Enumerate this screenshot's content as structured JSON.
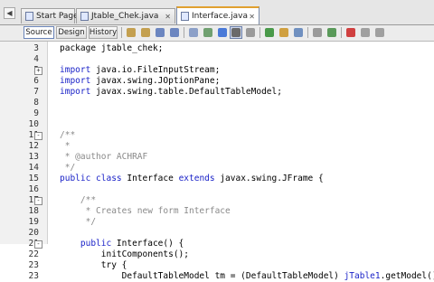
{
  "tabs": [
    {
      "label": "Start Page",
      "active": false
    },
    {
      "label": "Jtable_Chek.java",
      "active": false
    },
    {
      "label": "Interface.java",
      "active": true
    }
  ],
  "toolbar": {
    "modes": [
      "Source",
      "Design",
      "History"
    ],
    "icons": [
      "back-icon",
      "forward-icon",
      "find-previous-icon",
      "find-next-icon",
      "find-selection-icon",
      "toggle-highlight-icon",
      "toggle-bookmark-icon",
      "previous-bookmark-icon",
      "next-bookmark-icon",
      "shift-left-icon",
      "shift-right-icon",
      "start-macro-icon",
      "stop-macro-icon",
      "comment-icon",
      "uncomment-icon"
    ]
  },
  "colors": {
    "keyword": "#1a22c8",
    "comment": "#8a8a8a",
    "gutter": "#f1f1f1",
    "active_tab_marker": "#e0a030"
  },
  "editor": {
    "lines": [
      {
        "num": "3",
        "fold": "",
        "segments": [
          {
            "t": "package jtable_chek;",
            "c": ""
          }
        ]
      },
      {
        "num": "4",
        "fold": "",
        "segments": []
      },
      {
        "num": "5",
        "fold": "+",
        "segments": [
          {
            "t": "import",
            "c": "kw"
          },
          {
            "t": " java.io.FileInputStream;",
            "c": ""
          }
        ]
      },
      {
        "num": "6",
        "fold": "",
        "segments": [
          {
            "t": "import",
            "c": "kw"
          },
          {
            "t": " javax.swing.JOptionPane;",
            "c": ""
          }
        ]
      },
      {
        "num": "7",
        "fold": "",
        "segments": [
          {
            "t": "import",
            "c": "kw"
          },
          {
            "t": " javax.swing.table.DefaultTableModel;",
            "c": ""
          }
        ]
      },
      {
        "num": "8",
        "fold": "",
        "segments": []
      },
      {
        "num": "9",
        "fold": "",
        "segments": []
      },
      {
        "num": "10",
        "fold": "",
        "segments": []
      },
      {
        "num": "11",
        "fold": "-",
        "segments": [
          {
            "t": "/**",
            "c": "cm"
          }
        ]
      },
      {
        "num": "12",
        "fold": "",
        "segments": [
          {
            "t": " *",
            "c": "cm"
          }
        ]
      },
      {
        "num": "13",
        "fold": "",
        "segments": [
          {
            "t": " * @author ACHRAF",
            "c": "cm"
          }
        ]
      },
      {
        "num": "14",
        "fold": "",
        "segments": [
          {
            "t": " */",
            "c": "cm"
          }
        ]
      },
      {
        "num": "15",
        "fold": "",
        "segments": [
          {
            "t": "public class",
            "c": "kw"
          },
          {
            "t": " Interface ",
            "c": ""
          },
          {
            "t": "extends",
            "c": "kw"
          },
          {
            "t": " javax.swing.JFrame {",
            "c": ""
          }
        ]
      },
      {
        "num": "16",
        "fold": "",
        "segments": []
      },
      {
        "num": "17",
        "fold": "-",
        "segments": [
          {
            "t": "    /**",
            "c": "cm"
          }
        ]
      },
      {
        "num": "18",
        "fold": "",
        "segments": [
          {
            "t": "     * Creates new form Interface",
            "c": "cm"
          }
        ]
      },
      {
        "num": "19",
        "fold": "",
        "segments": [
          {
            "t": "     */",
            "c": "cm"
          }
        ]
      },
      {
        "num": "20",
        "fold": "",
        "segments": []
      },
      {
        "num": "21",
        "fold": "-",
        "segments": [
          {
            "t": "    public",
            "c": "kw"
          },
          {
            "t": " Interface() {",
            "c": ""
          }
        ]
      },
      {
        "num": "22",
        "fold": "",
        "segments": [
          {
            "t": "        initComponents();",
            "c": ""
          }
        ]
      },
      {
        "num": "23",
        "fold": "",
        "segments": [
          {
            "t": "        try {",
            "c": ""
          }
        ]
      },
      {
        "num": "23",
        "fold": "",
        "segments": [
          {
            "t": "            DefaultTableModel tm = (DefaultTableModel) ",
            "c": ""
          },
          {
            "t": "jTable1",
            "c": "err"
          },
          {
            "t": ".getModel();",
            "c": ""
          }
        ]
      }
    ]
  }
}
